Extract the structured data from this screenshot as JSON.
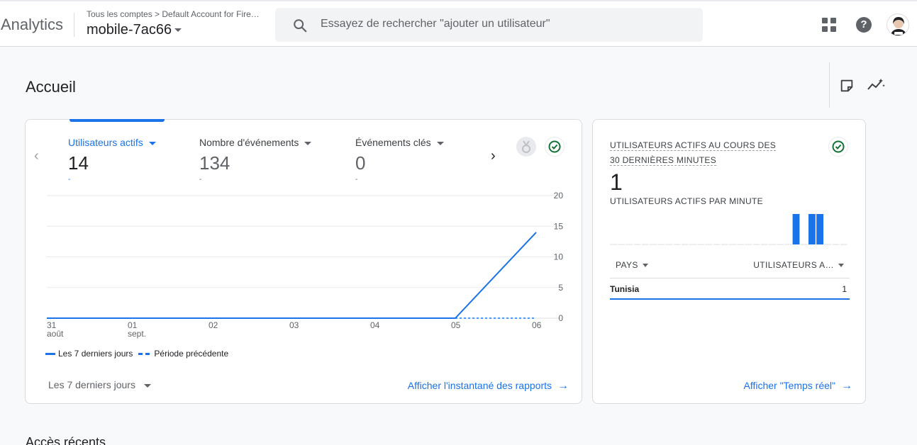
{
  "header": {
    "app_name": "Analytics",
    "breadcrumb": "Tous les comptes > Default Account for Fire…",
    "property": "mobile-7ac66",
    "search_placeholder": "Essayez de rechercher \"ajouter un utilisateur\"",
    "help_glyph": "?"
  },
  "page": {
    "title": "Accueil",
    "recent_title": "Accès récents"
  },
  "overview": {
    "metrics": [
      {
        "label": "Utilisateurs actifs",
        "value": "14",
        "delta": "-"
      },
      {
        "label": "Nombre d'événements",
        "value": "134",
        "delta": "-"
      },
      {
        "label": "Événements clés",
        "value": "0",
        "delta": "-"
      }
    ],
    "legend_current": "Les 7 derniers jours",
    "legend_previous": "Période précédente",
    "range_select": "Les 7 derniers jours",
    "report_link": "Afficher l'instantané des rapports",
    "chart_data": {
      "type": "line",
      "x": [
        "31 août",
        "01 sept.",
        "02",
        "03",
        "04",
        "05",
        "06"
      ],
      "x_tick_lines": [
        [
          "31",
          "août"
        ],
        [
          "01",
          "sept."
        ],
        [
          "02"
        ],
        [
          "03"
        ],
        [
          "04"
        ],
        [
          "05"
        ],
        [
          "06"
        ]
      ],
      "y_ticks": [
        0,
        5,
        10,
        15,
        20
      ],
      "ylim": [
        0,
        20
      ],
      "series": [
        {
          "name": "Les 7 derniers jours",
          "style": "solid",
          "values": [
            0,
            0,
            0,
            0,
            0,
            0,
            14
          ]
        },
        {
          "name": "Période précédente",
          "style": "dashed",
          "values": [
            null,
            null,
            null,
            null,
            null,
            0,
            0
          ]
        }
      ],
      "color": "#1a73e8",
      "grid": true
    }
  },
  "realtime": {
    "title_line1": "UTILISATEURS ACTIFS AU COURS DES",
    "title_line2": "30 DERNIÈRES MINUTES",
    "value": "1",
    "per_minute_label": "UTILISATEURS ACTIFS PAR MINUTE",
    "bars": [
      0,
      0,
      0,
      0,
      0,
      0,
      0,
      0,
      0,
      0,
      0,
      0,
      0,
      0,
      0,
      0,
      0,
      0,
      0,
      0,
      0,
      0,
      0,
      1,
      0,
      1,
      1,
      0,
      0,
      0
    ],
    "table_headers": [
      "PAYS",
      "UTILISATEURS A…"
    ],
    "rows": [
      {
        "country": "Tunisia",
        "users": "1"
      }
    ],
    "link": "Afficher \"Temps réel\""
  },
  "colors": {
    "accent": "#1a73e8",
    "success": "#137333"
  }
}
